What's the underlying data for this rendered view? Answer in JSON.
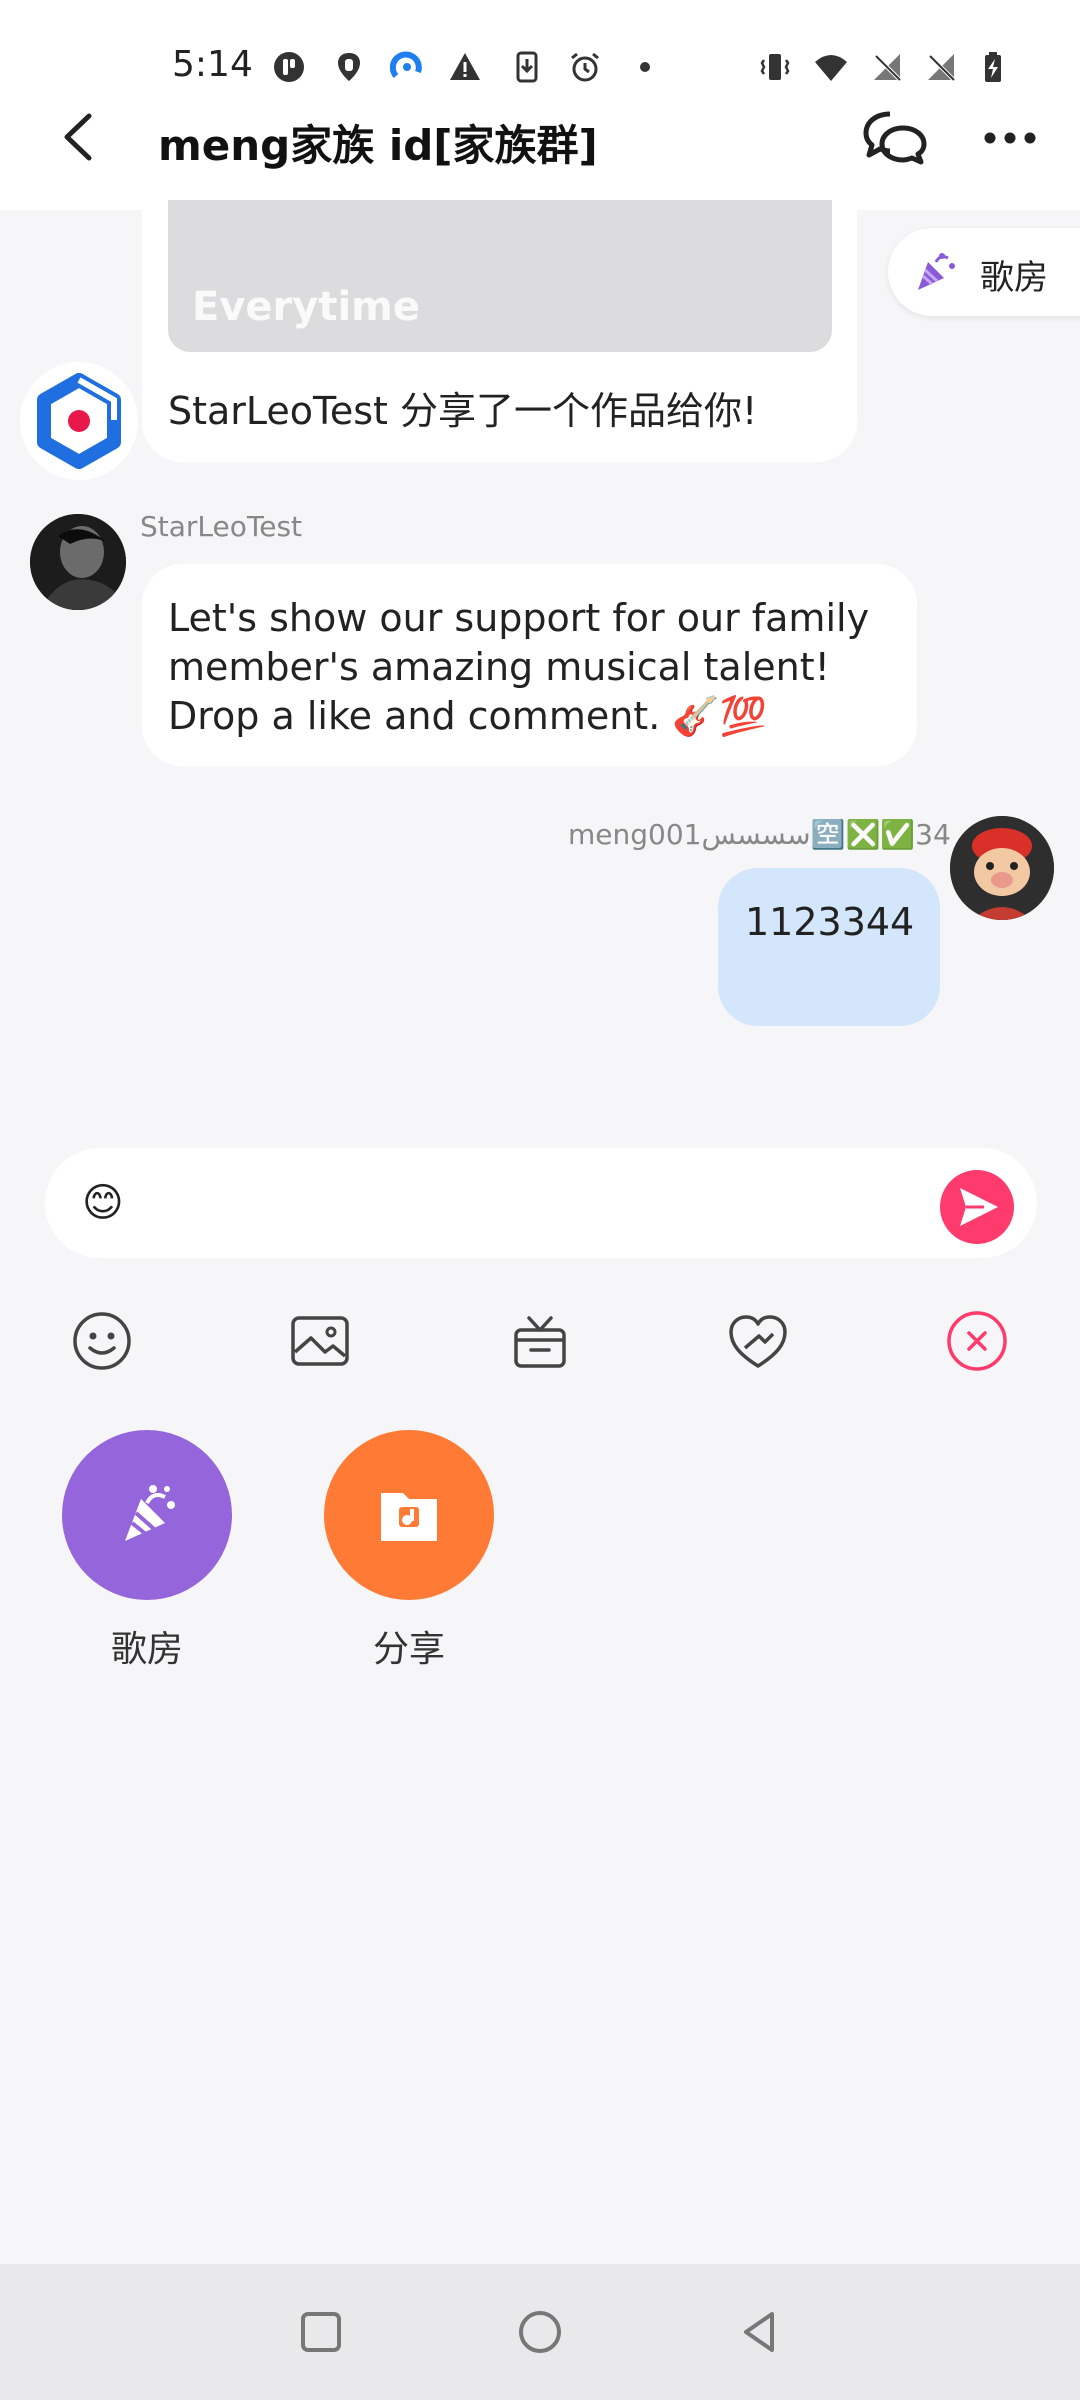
{
  "status_bar": {
    "time": "5:14"
  },
  "header": {
    "title": "meng家族 id[家族群]",
    "back_icon": "back-arrow-icon",
    "chat_icon": "chat-bubbles-icon",
    "more_icon": "more-dots-icon"
  },
  "floating_entry": {
    "label": "歌房",
    "icon": "party-popper-icon"
  },
  "messages": [
    {
      "type": "share",
      "thumbnail_text": "Everytime",
      "caption": "StarLeoTest 分享了一个作品给你!"
    },
    {
      "type": "text",
      "sender": "StarLeoTest",
      "text": "Let's show our support for our family member's amazing musical talent! Drop a like and comment. 🎸💯"
    },
    {
      "type": "text",
      "sender": "meng001سسسس🈳❎✅34",
      "text": "1123344",
      "self": true
    }
  ],
  "input": {
    "value": "😊",
    "send_icon": "send-icon"
  },
  "toolbar": [
    {
      "icon": "emoji-icon"
    },
    {
      "icon": "image-icon"
    },
    {
      "icon": "gift-icon"
    },
    {
      "icon": "heart-handshake-icon"
    },
    {
      "icon": "close-panel-icon"
    }
  ],
  "functions": [
    {
      "label": "歌房",
      "color": "#9565db",
      "icon": "ktv-room-icon"
    },
    {
      "label": "分享",
      "color": "#ff7a35",
      "icon": "share-music-icon"
    }
  ],
  "colors": {
    "accent_pink": "#ff3a6d",
    "self_bubble": "#d4e6fc",
    "background": "#f6f6f8"
  }
}
